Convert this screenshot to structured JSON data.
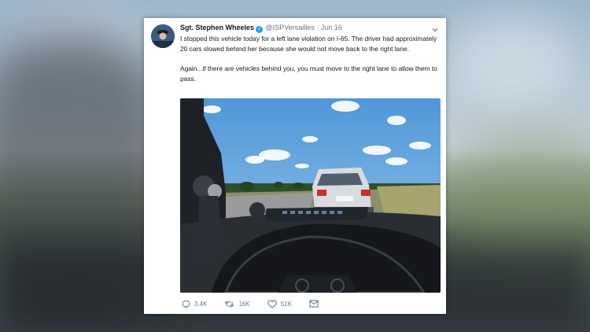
{
  "tweet": {
    "author_name": "Sgt. Stephen Wheeles",
    "handle": "@ISPVersailles",
    "separator": "·",
    "date": "Jun 16",
    "paragraph1": "I stopped this vehicle today for a left lane violation on I-65.  The driver had approximately 20 cars slowed behind her because she would not move back to the right lane.",
    "paragraph2": "Again...if there are vehicles behind you, you must move to the right lane to allow them to pass.",
    "replies": "3.4K",
    "retweets": "16K",
    "likes": "51K"
  },
  "icons": {
    "verified": "verified-badge-icon",
    "caret": "chevron-down-icon",
    "reply": "reply-icon",
    "retweet": "retweet-icon",
    "like": "heart-icon",
    "message": "envelope-icon"
  },
  "colors": {
    "verified": "#1da1f2",
    "meta_text": "#657786",
    "body_text": "#14171a"
  }
}
